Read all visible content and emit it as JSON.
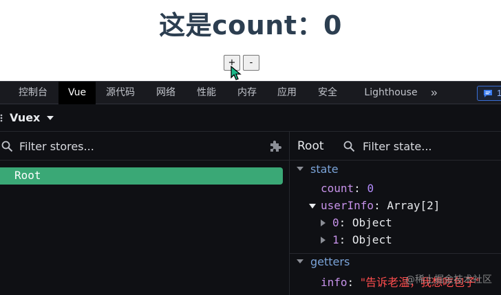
{
  "page": {
    "title": "这是count：0",
    "increment_label": "+",
    "decrement_label": "-"
  },
  "devtools": {
    "tabs": [
      {
        "label": "控制台"
      },
      {
        "label": "Vue",
        "active": true
      },
      {
        "label": "源代码"
      },
      {
        "label": "网络"
      },
      {
        "label": "性能"
      },
      {
        "label": "内存"
      },
      {
        "label": "应用"
      },
      {
        "label": "安全"
      },
      {
        "label": "Lighthouse"
      }
    ],
    "more_tabs_icon": "»",
    "issues_count": "1",
    "vuex": {
      "title": "Vuex",
      "stores_filter_placeholder": "Filter stores...",
      "stores": [
        {
          "label": "Root",
          "selected": true
        }
      ],
      "inspector_title": "Root",
      "state_filter_placeholder": "Filter state...",
      "state_section": "state",
      "getters_section": "getters",
      "state": {
        "count_key": "count",
        "count_value": "0",
        "userinfo_key": "userInfo",
        "userinfo_type": "Array[2]",
        "items": [
          {
            "key": "0",
            "type": "Object"
          },
          {
            "key": "1",
            "type": "Object"
          }
        ]
      },
      "getters": {
        "info_key": "info",
        "info_value": "\"告诉老温，我想吃包子\""
      }
    }
  },
  "watermark": "@稀土掘金技术社区",
  "colors": {
    "accent_green": "#3aa876",
    "state_key": "#c792ea",
    "string_value": "#ff4d4d",
    "number_value": "#b58cff",
    "section_label": "#7aa3d8"
  }
}
